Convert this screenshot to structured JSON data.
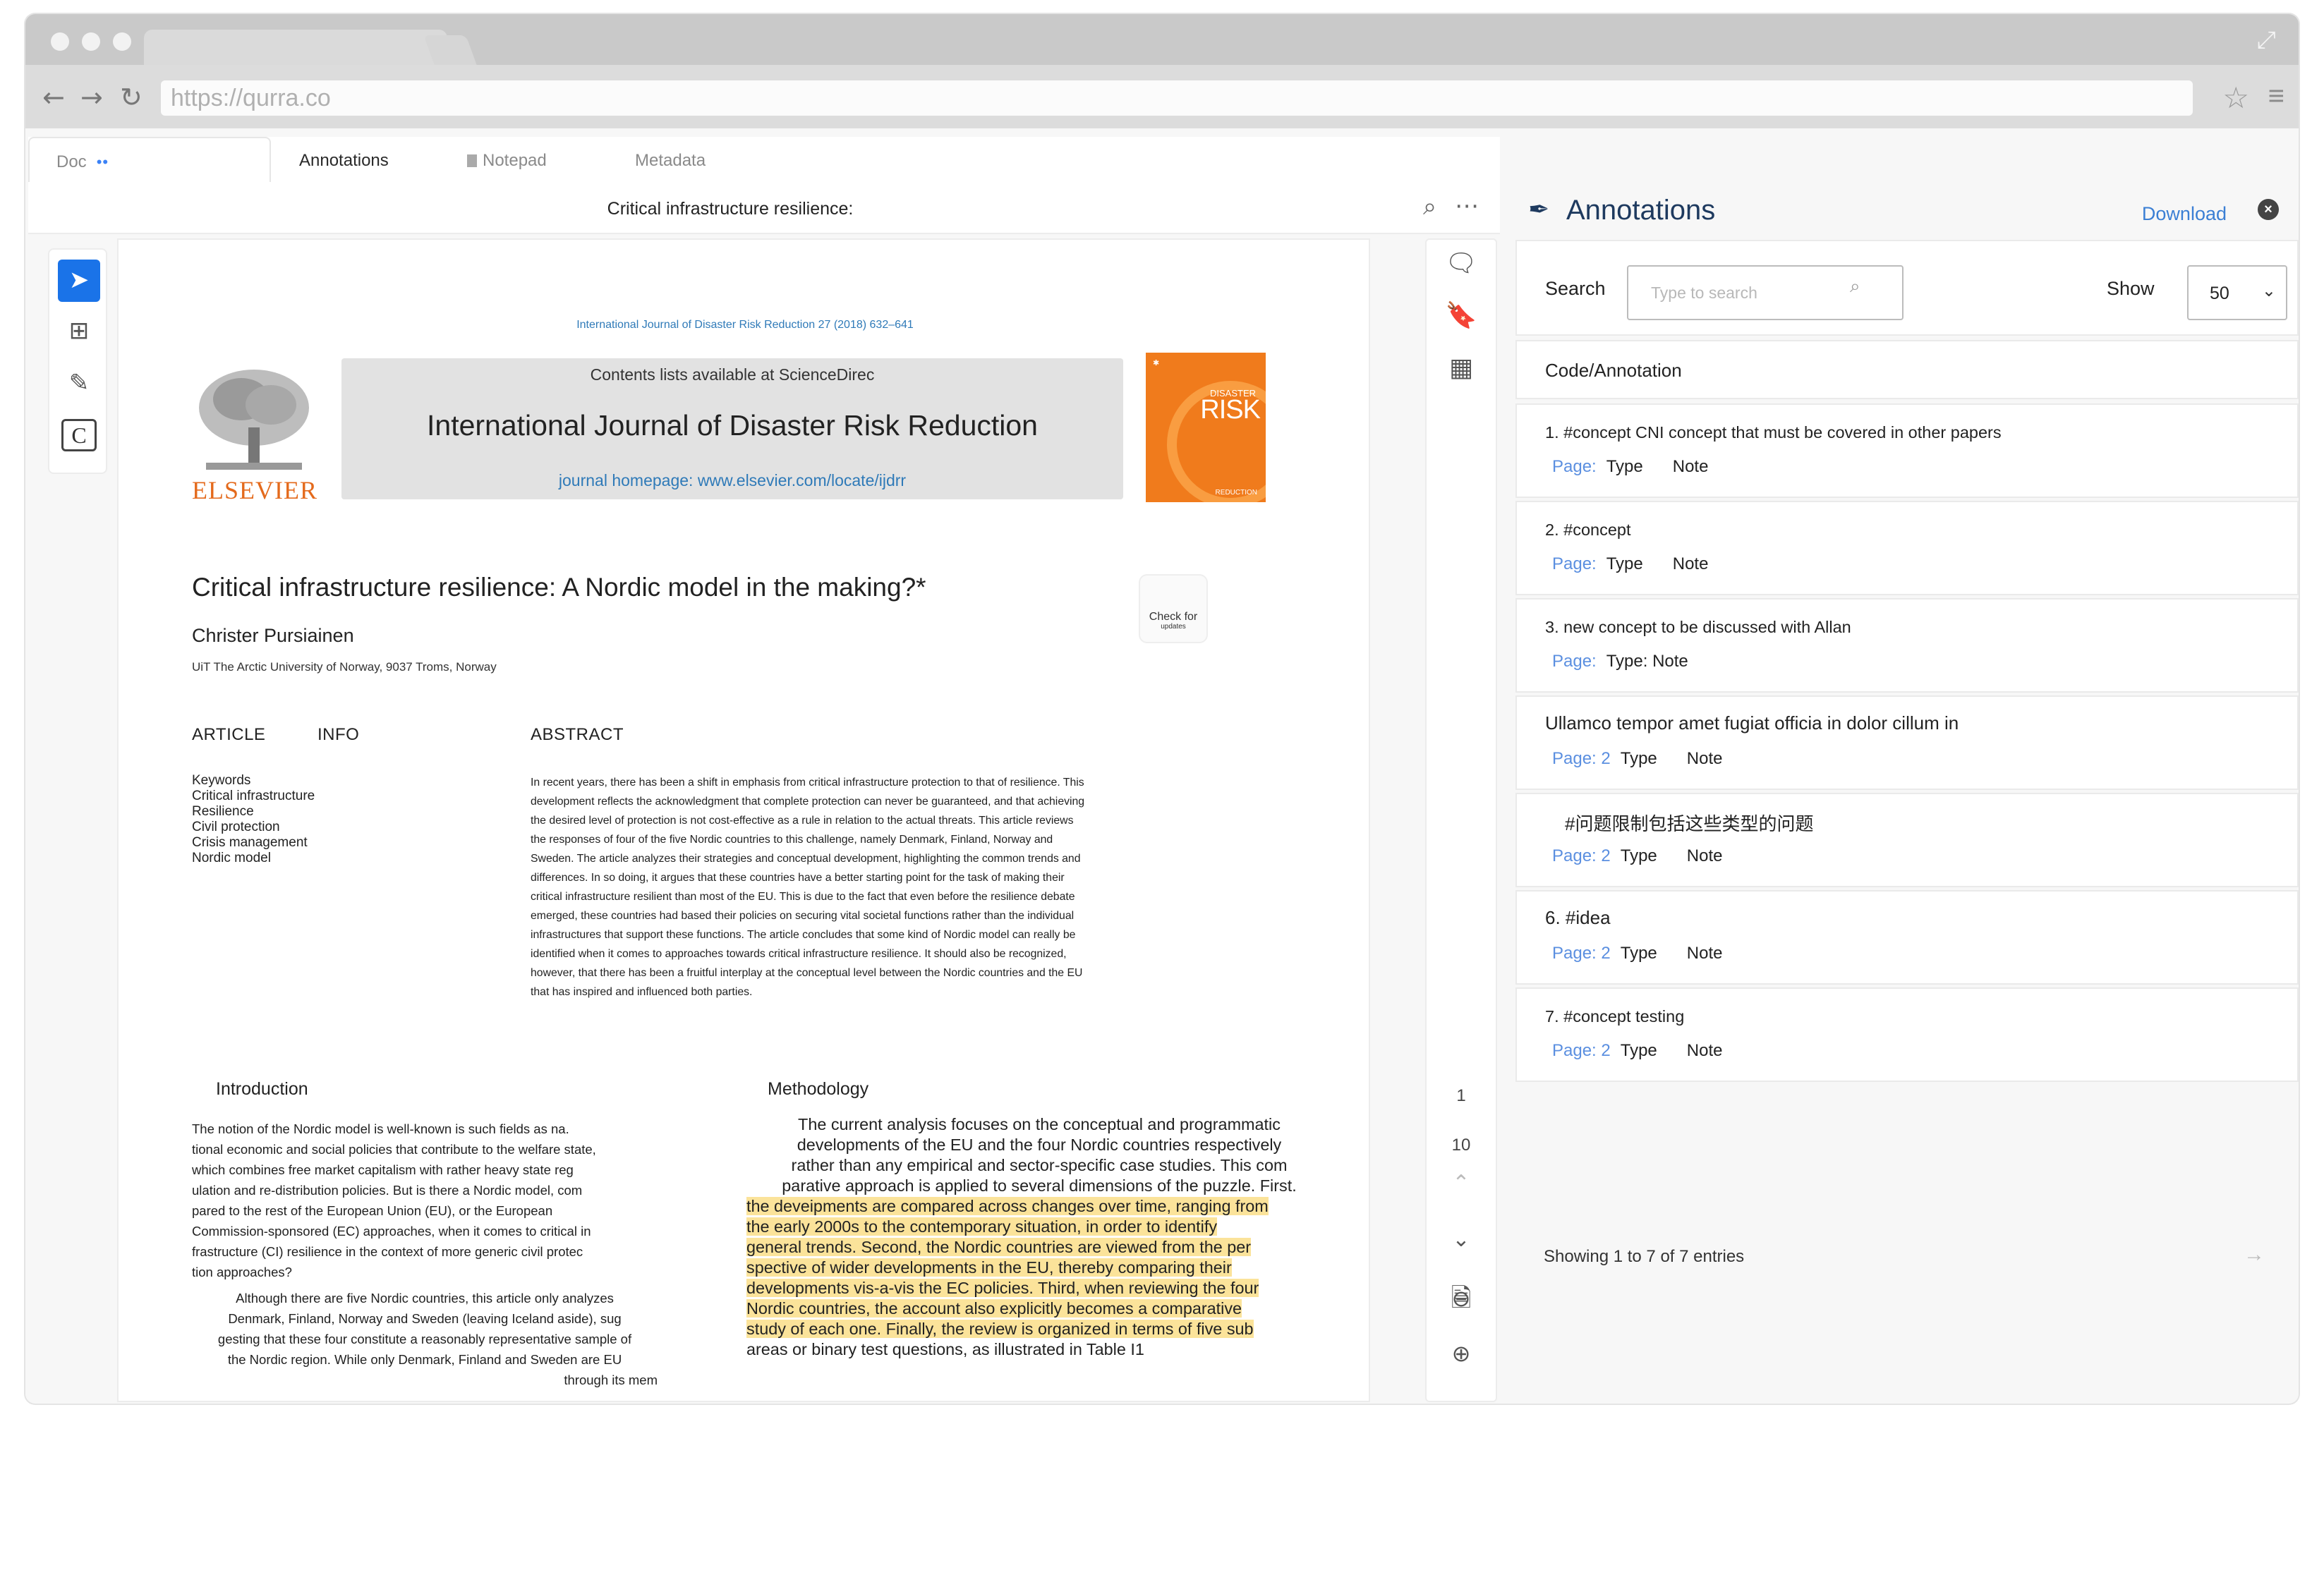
{
  "browser": {
    "url": "https://qurra.co"
  },
  "tabs": {
    "doc": "Doc",
    "doc_dots": "••",
    "annotations": "Annotations",
    "notepad": "Notepad",
    "metadata": "Metadata"
  },
  "doc_header": {
    "title": "Critical infrastructure resilience:"
  },
  "pdf": {
    "journal_ref": "International Journal of Disaster Risk Reduction 27 (2018) 632–641",
    "publisher": "ELSEVIER",
    "contents_line": "Contents lists available at ScienceDirec",
    "journal_title": "International Journal of Disaster Risk Reduction",
    "journal_home": "journal homepage: www.elsevier.com/locate/ijdrr",
    "cover_small": "DISASTER",
    "cover_big": "RISK",
    "cover_sub": "REDUCTION",
    "paper_title": "Critical infrastructure resilience: A Nordic model in the making?*",
    "author": "Christer Pursiainen",
    "affiliation": "UiT The Arctic University of Norway, 9037 Troms, Norway",
    "check_updates": "Check for",
    "check_updates_sub": "updates",
    "article_label": "ARTICLE",
    "info_label": "INFO",
    "abstract_label": "ABSTRACT",
    "keywords": [
      "Keywords",
      "Critical infrastructure",
      "Resilience",
      "Civil protection",
      "Crisis management",
      "Nordic model"
    ],
    "abstract_lines": [
      "In recent years, there has been a shift in emphasis from critical infrastructure protection to that of resilience. This",
      "development reflects the acknowledgment that complete protection can never be guaranteed, and that achieving",
      "the desired level of protection is not cost-effective as a rule in relation to the actual threats. This article reviews",
      "the responses of four of the five Nordic countries to this challenge, namely Denmark, Finland, Norway and",
      "Sweden. The article analyzes their strategies and conceptual development, highlighting the common trends and",
      "differences. In so doing, it argues that these countries have a better starting point for the task of making their",
      "critical infrastructure resilient than most of the EU. This is due to the fact that even before the resilience debate",
      "emerged, these countries had based their policies on securing vital societal functions rather than the individual",
      "infrastructures that support these functions. The article concludes that some kind of Nordic model can really be",
      "identified when it comes to approaches towards critical infrastructure resilience. It should also be recognized,",
      "however, that there has been a fruitful interplay at the conceptual level between the Nordic countries and the EU",
      "that has inspired and influenced both parties."
    ],
    "intro_heading": "Introduction",
    "method_heading": "Methodology",
    "intro_p1_lines": [
      "The notion of the Nordic model is well-known is such fields as na.",
      "tional economic and social policies that contribute to the welfare state,",
      "which combines free market capitalism with rather heavy state reg",
      "ulation and re-distribution policies. But is there a Nordic model, com",
      "pared to the rest of the European Union (EU), or the European",
      "Commission-sponsored (EC) approaches, when it comes to critical in",
      "frastructure (CI) resilience in the context of more generic civil protec",
      "tion approaches?"
    ],
    "intro_p2_lines": [
      "Although there are five Nordic countries, this article only analyzes",
      "Denmark, Finland, Norway and Sweden (leaving Iceland aside), sug",
      "gesting that these four constitute a reasonably representative sample of",
      "the Nordic region. While only Denmark, Finland and Sweden are EU",
      "through its mem"
    ],
    "method_lines": [
      "The current analysis focuses on the conceptual and programmatic",
      "developments of the EU and the four Nordic countries respectively",
      "rather than any empirical and sector-specific case studies. This com",
      "parative approach is applied to several dimensions of the puzzle. First."
    ],
    "method_highlight_lines": [
      "the deveipments are compared across changes over time, ranging from",
      "the early 2000s to the contemporary situation, in order to identify",
      "general trends. Second, the Nordic countries are viewed from the per",
      "spective of wider developments in the EU, thereby comparing their",
      "developments vis-a-vis the EC policies. Third, when reviewing the four",
      "Nordic countries, the account also explicitly becomes a comparative",
      "study of each one. Finally, the review is organized in terms of five sub"
    ],
    "method_tail": "areas or binary test questions, as illustrated in Table I1"
  },
  "vstrip": {
    "page_current": "1",
    "page_total": "10"
  },
  "panel": {
    "title": "Annotations",
    "download": "Download",
    "search_label": "Search",
    "search_placeholder": "Type to search",
    "show_label": "Show",
    "show_value": "50",
    "column_title": "Code/Annotation",
    "annotations": [
      {
        "text": "1. #concept CNI concept that must be covered in other papers",
        "page": "Page:",
        "type": "Type",
        "note": "Note"
      },
      {
        "text": "2. #concept",
        "page": "Page:",
        "type": "Type",
        "note": "Note"
      },
      {
        "text": "3. new concept to be discussed with Allan",
        "page": "Page:",
        "type": "Type: Note",
        "note": ""
      },
      {
        "text": "Ullamco tempor amet fugiat officia in dolor cillum in",
        "page": "Page: 2",
        "type": "Type",
        "note": "Note"
      },
      {
        "text": "#问题限制包括这些类型的问题",
        "page": "Page: 2",
        "type": "Type",
        "note": "Note"
      },
      {
        "text": "6. #idea",
        "page": "Page: 2",
        "type": "Type",
        "note": "Note"
      },
      {
        "text": "7. #concept testing",
        "page": "Page: 2",
        "type": "Type",
        "note": "Note"
      }
    ],
    "showing": "Showing 1 to 7 of 7 entries"
  }
}
